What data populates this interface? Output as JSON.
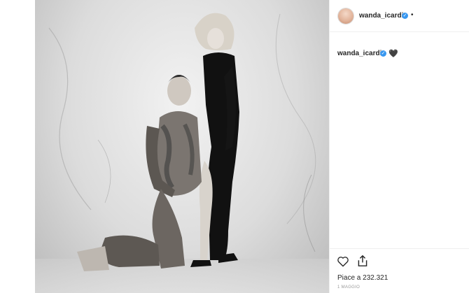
{
  "post": {
    "image_alt": "Black and white photo of a tattooed man kneeling beside a woman in a black dress",
    "username": "wanda_icardi",
    "more": "•",
    "caption": {
      "username": "wanda_icardi",
      "text": "🖤"
    },
    "likes": "Piace a 232.321",
    "date": "1 MAGGIO"
  },
  "icons": {
    "avatar": "avatar",
    "verified": "verified-badge-icon",
    "like": "heart-outline-icon",
    "share": "share-icon"
  },
  "colors": {
    "text": "#262626",
    "secondary": "#999999",
    "verified": "#3897f0",
    "border": "#efefef"
  }
}
